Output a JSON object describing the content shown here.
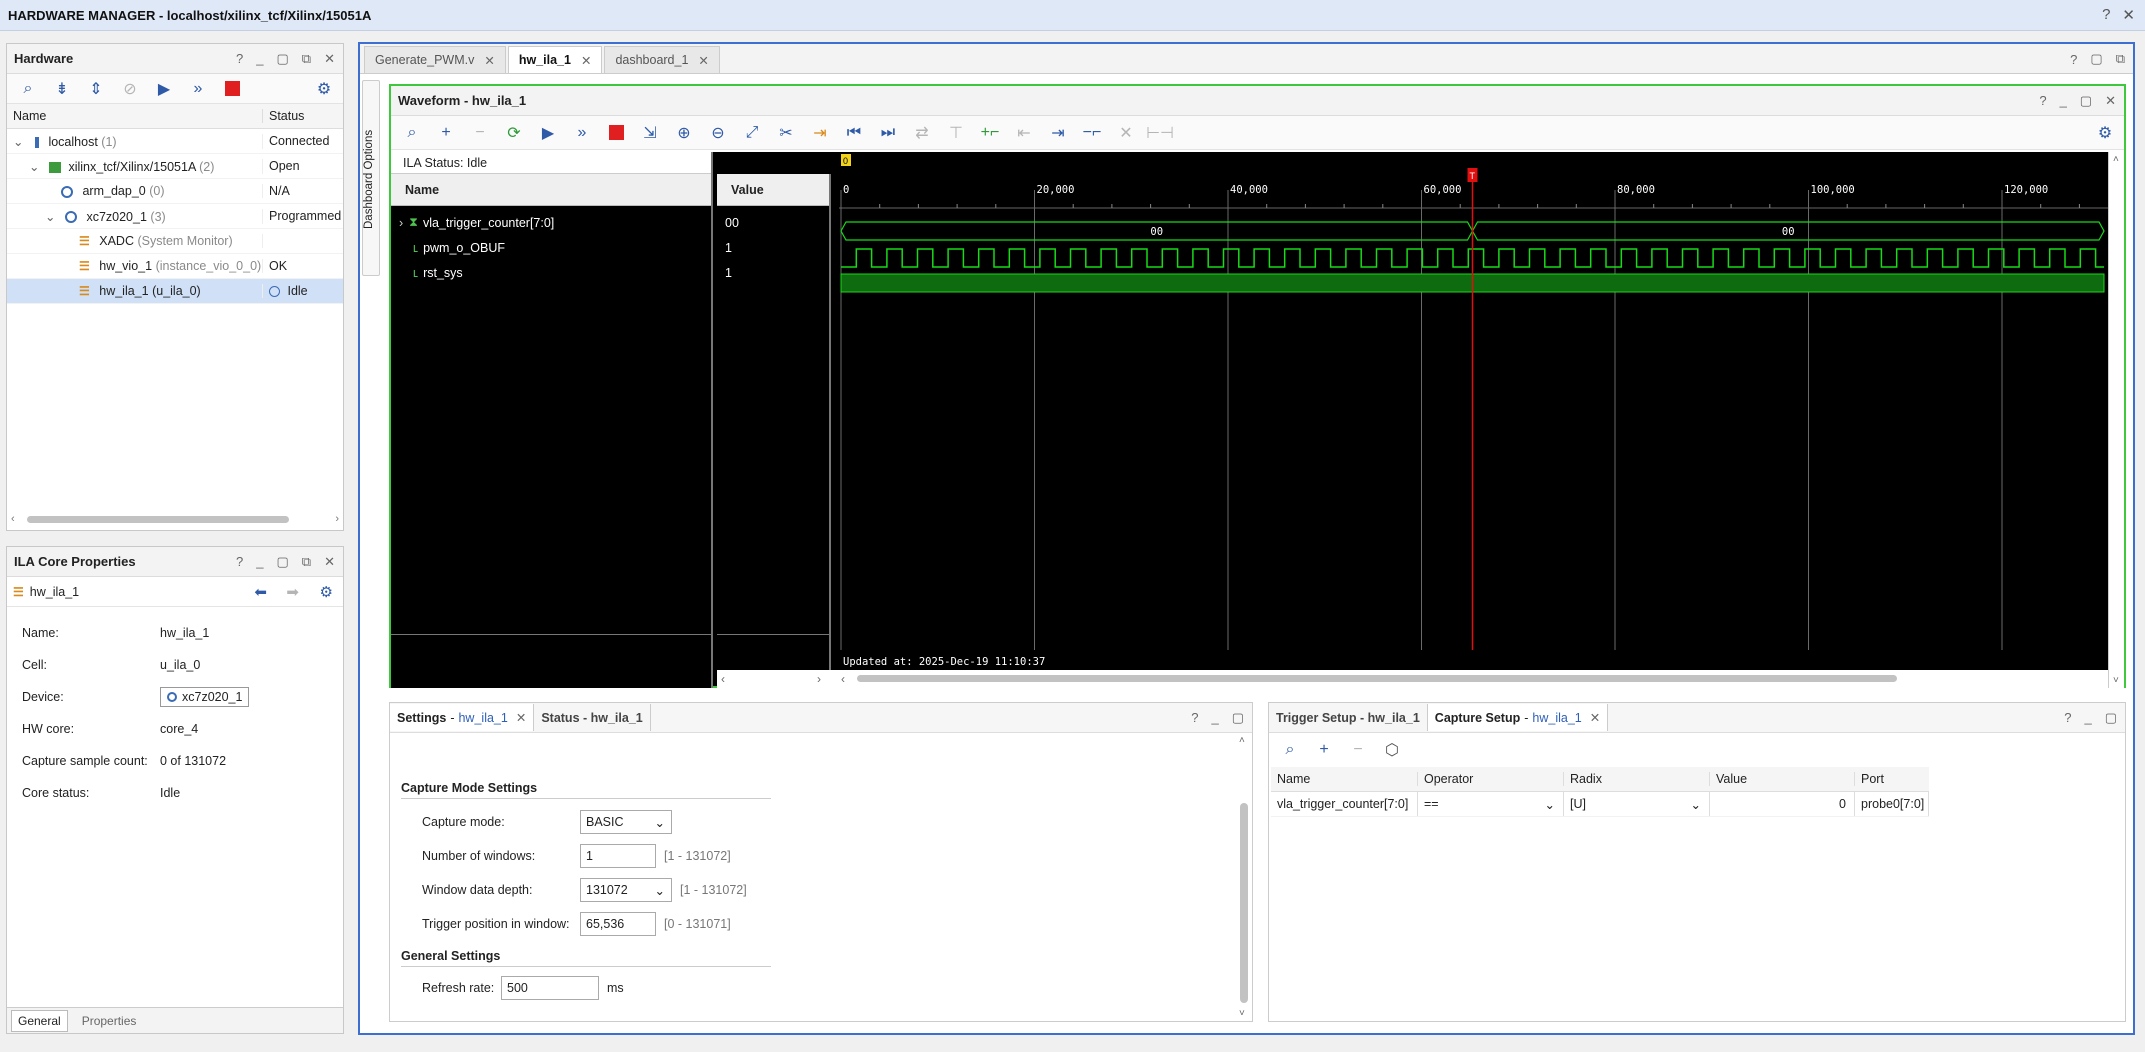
{
  "window": {
    "title": "HARDWARE MANAGER - localhost/xilinx_tcf/Xilinx/15051A",
    "help": "?",
    "close": "✕"
  },
  "hardware": {
    "title": "Hardware",
    "col_name": "Name",
    "col_status": "Status",
    "rows": [
      {
        "name": "localhost",
        "count": "(1)",
        "status": "Connected"
      },
      {
        "name": "xilinx_tcf/Xilinx/15051A",
        "count": "(2)",
        "status": "Open"
      },
      {
        "name": "arm_dap_0",
        "count": "(0)",
        "status": "N/A"
      },
      {
        "name": "xc7z020_1",
        "count": "(3)",
        "status": "Programmed"
      },
      {
        "name": "XADC",
        "count": "(System Monitor)",
        "status": ""
      },
      {
        "name": "hw_vio_1",
        "count": "(instance_vio_0_0)",
        "status": "OK"
      },
      {
        "name": "hw_ila_1",
        "count": "(u_ila_0)",
        "status": "Idle"
      }
    ]
  },
  "ila_props": {
    "title": "ILA Core Properties",
    "object": "hw_ila_1",
    "rows": [
      {
        "k": "Name:",
        "v": "hw_ila_1"
      },
      {
        "k": "Cell:",
        "v": "u_ila_0"
      },
      {
        "k": "Device:",
        "v": "xc7z020_1"
      },
      {
        "k": "HW core:",
        "v": "core_4"
      },
      {
        "k": "Capture sample count:",
        "v": "0 of 131072"
      },
      {
        "k": "Core status:",
        "v": "Idle"
      }
    ],
    "tab_general": "General",
    "tab_properties": "Properties"
  },
  "editor_tabs": [
    {
      "label": "Generate_PWM.v"
    },
    {
      "label": "hw_ila_1"
    },
    {
      "label": "dashboard_1"
    }
  ],
  "dashboard_options": "Dashboard Options",
  "waveform": {
    "title": "Waveform - hw_ila_1",
    "ila_status": "ILA Status:  Idle",
    "col_name": "Name",
    "col_value": "Value",
    "signals": [
      {
        "name": "vla_trigger_counter[7:0]",
        "value": "00"
      },
      {
        "name": "pwm_o_OBUF",
        "value": "1"
      },
      {
        "name": "rst_sys",
        "value": "1"
      }
    ],
    "bus_value_label": "00",
    "ticks": [
      "0",
      "20,000",
      "40,000",
      "60,000",
      "80,000",
      "100,000",
      "120,000"
    ],
    "marker_zero": "0",
    "marker_t": "T",
    "updated": "Updated at: 2025-Dec-19 11:10:37",
    "trigger_fraction": 0.5
  },
  "settings": {
    "tab1": "Settings",
    "tab1_sub": "hw_ila_1",
    "tab2": "Status - hw_ila_1",
    "capture_head": "Capture Mode Settings",
    "capture_mode_label": "Capture mode:",
    "capture_mode_value": "BASIC",
    "num_windows_label": "Number of windows:",
    "num_windows_value": "1",
    "num_windows_range": "[1 - 131072]",
    "depth_label": "Window data depth:",
    "depth_value": "131072",
    "depth_range": "[1 - 131072]",
    "trigpos_label": "Trigger position in window:",
    "trigpos_value": "65,536",
    "trigpos_range": "[0 - 131071]",
    "general_head": "General Settings",
    "refresh_label": "Refresh rate:",
    "refresh_value": "500",
    "refresh_unit": "ms"
  },
  "capture": {
    "tab1": "Trigger Setup - hw_ila_1",
    "tab2": "Capture Setup",
    "tab2_sub": "hw_ila_1",
    "cols": [
      "Name",
      "Operator",
      "Radix",
      "Value",
      "Port"
    ],
    "row": {
      "name": "vla_trigger_counter[7:0]",
      "operator": "==",
      "radix": "[U]",
      "value": "0",
      "port": "probe0[7:0]"
    }
  }
}
